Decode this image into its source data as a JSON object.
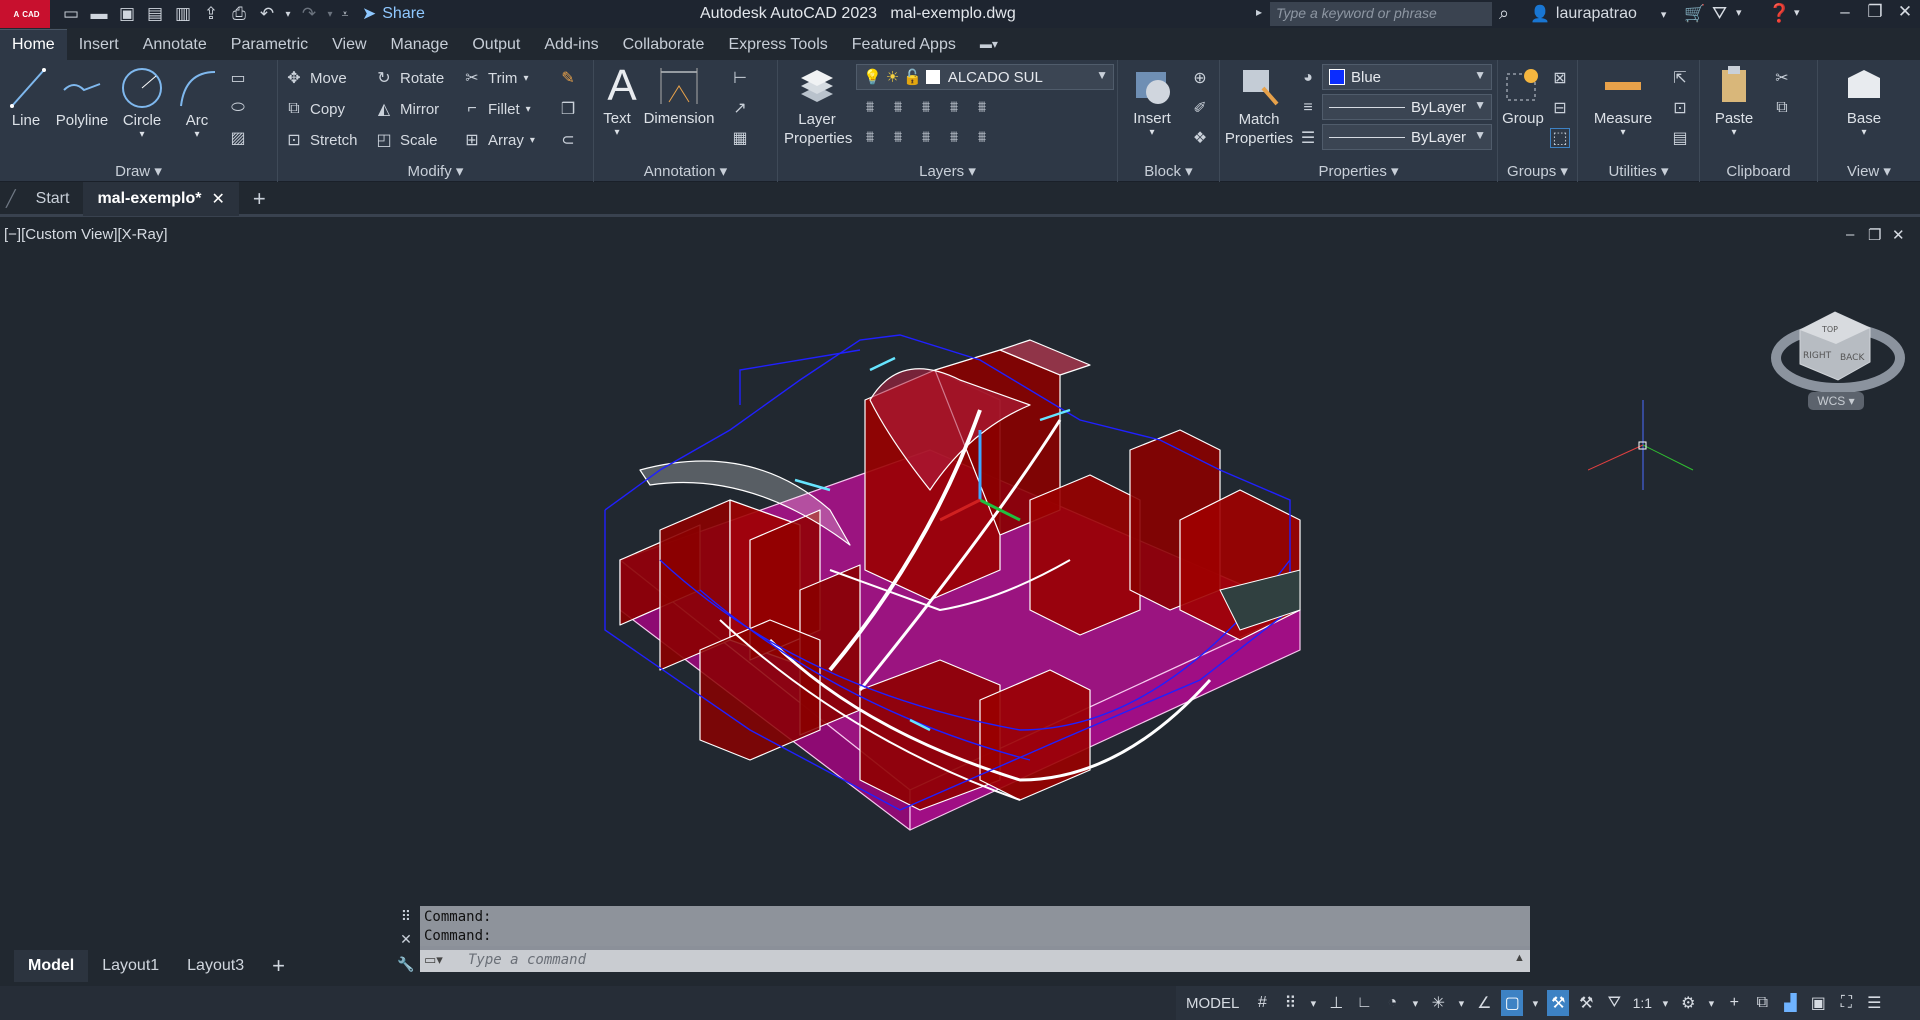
{
  "app": {
    "title": "Autodesk AutoCAD 2023",
    "file": "mal-exemplo.dwg",
    "logo_text": "A",
    "logo_sub": "CAD"
  },
  "quick_access": {
    "share_label": "Share"
  },
  "search": {
    "placeholder": "Type a keyword or phrase"
  },
  "user": {
    "name": "laurapatrao"
  },
  "menu_tabs": [
    "Home",
    "Insert",
    "Annotate",
    "Parametric",
    "View",
    "Manage",
    "Output",
    "Add-ins",
    "Collaborate",
    "Express Tools",
    "Featured Apps"
  ],
  "ribbon": {
    "draw": {
      "title": "Draw",
      "line": "Line",
      "polyline": "Polyline",
      "circle": "Circle",
      "arc": "Arc"
    },
    "modify": {
      "title": "Modify",
      "move": "Move",
      "rotate": "Rotate",
      "trim": "Trim",
      "copy": "Copy",
      "mirror": "Mirror",
      "fillet": "Fillet",
      "stretch": "Stretch",
      "scale": "Scale",
      "array": "Array"
    },
    "annotation": {
      "title": "Annotation",
      "text": "Text",
      "dimension": "Dimension"
    },
    "layers": {
      "title": "Layers",
      "layer_properties": "Layer Properties",
      "current_layer": "ALCADO SUL"
    },
    "block": {
      "title": "Block",
      "insert": "Insert"
    },
    "properties": {
      "title": "Properties",
      "match": "Match Properties",
      "color": "Blue",
      "linetype": "ByLayer",
      "lineweight": "ByLayer",
      "color_hex": "#0a2cff"
    },
    "groups": {
      "title": "Groups",
      "group": "Group"
    },
    "utilities": {
      "title": "Utilities",
      "measure": "Measure"
    },
    "clipboard": {
      "title": "Clipboard",
      "paste": "Paste"
    },
    "view": {
      "title": "View",
      "base": "Base"
    }
  },
  "doc_tabs": {
    "start": "Start",
    "active": "mal-exemplo*"
  },
  "viewport": {
    "label": "[−][Custom View][X-Ray]",
    "viewcube_right": "RIGHT",
    "viewcube_back": "BACK",
    "viewcube_top": "TOP",
    "wcs": "WCS"
  },
  "command": {
    "history": [
      "Command:",
      "Command:"
    ],
    "placeholder": "Type a command"
  },
  "layout_tabs": [
    "Model",
    "Layout1",
    "Layout3"
  ],
  "status": {
    "model": "MODEL",
    "scale": "1:1"
  }
}
